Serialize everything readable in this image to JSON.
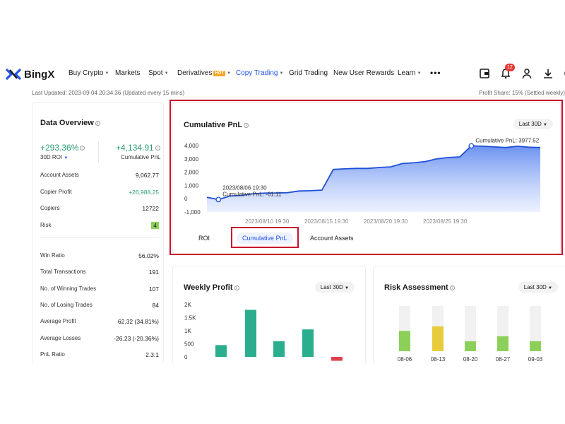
{
  "brand": {
    "name": "BingX"
  },
  "nav": {
    "items": [
      {
        "label": "Buy Crypto",
        "caret": true
      },
      {
        "label": "Markets"
      },
      {
        "label": "Spot",
        "caret": true
      },
      {
        "label": "Derivatives",
        "hot": "HOT",
        "caret": true
      },
      {
        "label": "Copy Trading",
        "caret": true,
        "active": true
      },
      {
        "label": "Grid Trading"
      },
      {
        "label": "New User Rewards"
      },
      {
        "label": "Learn",
        "caret": true
      }
    ],
    "more": "•••",
    "notification_count": "12"
  },
  "subbar": {
    "last_updated": "Last Updated: 2023-09-04 20:34:36 (Updated every 15 mins)",
    "profit_share": "Profit Share: 15% (Settled weekly)"
  },
  "overview": {
    "title": "Data Overview",
    "roi_value": "+293.36%",
    "roi_label": "30D ROI",
    "pnl_value": "+4,134.91",
    "pnl_label": "Cumulative PnL",
    "rows_a": [
      {
        "label": "Account Assets",
        "value": "9,062.77"
      },
      {
        "label": "Copier Profit",
        "value": "+26,988.25",
        "green": true
      },
      {
        "label": "Copiers",
        "value": "12722"
      },
      {
        "label": "Risk",
        "value": "4",
        "badge": true
      }
    ],
    "rows_b": [
      {
        "label": "Win Ratio",
        "value": "56.02%"
      },
      {
        "label": "Total Transactions",
        "value": "191"
      },
      {
        "label": "No. of Winning Trades",
        "value": "107"
      },
      {
        "label": "No. of Losing Trades",
        "value": "84"
      },
      {
        "label": "Average Profit",
        "value": "62.32 (34.81%)"
      },
      {
        "label": "Average Losses",
        "value": "-26.23 (-20.36%)"
      },
      {
        "label": "PnL Ratio",
        "value": "2.3:1"
      }
    ]
  },
  "pnl_panel": {
    "title": "Cumulative PnL",
    "range": "Last 30D",
    "tabs": [
      "ROI",
      "Cumulative PnL",
      "Account Assets"
    ],
    "active_tab": 1
  },
  "weekly_panel": {
    "title": "Weekly Profit",
    "range": "Last 30D"
  },
  "risk_panel": {
    "title": "Risk Assessment",
    "range": "Last 30D"
  },
  "chart_data": [
    {
      "type": "area",
      "title": "Cumulative PnL",
      "ylim": [
        -1000,
        4000
      ],
      "yticks": [
        "4,000",
        "3,000",
        "2,000",
        "1,000",
        "0",
        "-1,000"
      ],
      "yticks_values": [
        4000,
        3000,
        2000,
        1000,
        0,
        -1000
      ],
      "xticks": [
        "2023/08/10 19:30",
        "2023/08/15 19:30",
        "2023/08/20 19:30",
        "2023/08/25 19:30"
      ],
      "x": [
        "08/05",
        "08/06",
        "08/07",
        "08/08",
        "08/09",
        "08/10",
        "08/11",
        "08/12",
        "08/13",
        "08/14",
        "08/15",
        "08/16",
        "08/17",
        "08/18",
        "08/19",
        "08/20",
        "08/21",
        "08/22",
        "08/23",
        "08/24",
        "08/25",
        "08/26",
        "08/27",
        "08/28",
        "08/29",
        "08/30",
        "08/31",
        "09/01",
        "09/02",
        "09/03"
      ],
      "values": [
        100,
        -61.11,
        200,
        250,
        380,
        420,
        430,
        450,
        580,
        600,
        650,
        2200,
        2250,
        2280,
        2280,
        2350,
        2400,
        2650,
        2700,
        2800,
        3000,
        3100,
        3150,
        3977.52,
        3950,
        3900,
        3850,
        3950,
        3880,
        3850
      ],
      "annotations": [
        {
          "date": "2023/08/06 19:30",
          "label": "Cumulative PnL: -61.11",
          "index": 1
        },
        {
          "date": "2023/08/28 19:30",
          "label": "Cumulative PnL: 3977.52",
          "index": 23
        }
      ],
      "color": "#2354e6"
    },
    {
      "type": "bar",
      "title": "Weekly Profit",
      "yticks": [
        "2K",
        "1.5K",
        "1K",
        "500",
        "0"
      ],
      "yticks_values": [
        2000,
        1500,
        1000,
        500,
        0
      ],
      "ylim": [
        0,
        2000
      ],
      "values": [
        450,
        1800,
        600,
        1050,
        -150
      ],
      "colors": [
        "#2aae8d",
        "#2aae8d",
        "#2aae8d",
        "#2aae8d",
        "#e04050"
      ]
    },
    {
      "type": "bar",
      "title": "Risk Assessment",
      "categories": [
        "08-06",
        "08-13",
        "08-20",
        "08-27",
        "09-03"
      ],
      "values": [
        0.45,
        0.55,
        0.22,
        0.33,
        0.22
      ],
      "colors": [
        "#8cd05a",
        "#e8cc3c",
        "#8cd05a",
        "#8cd05a",
        "#8cd05a"
      ]
    }
  ]
}
